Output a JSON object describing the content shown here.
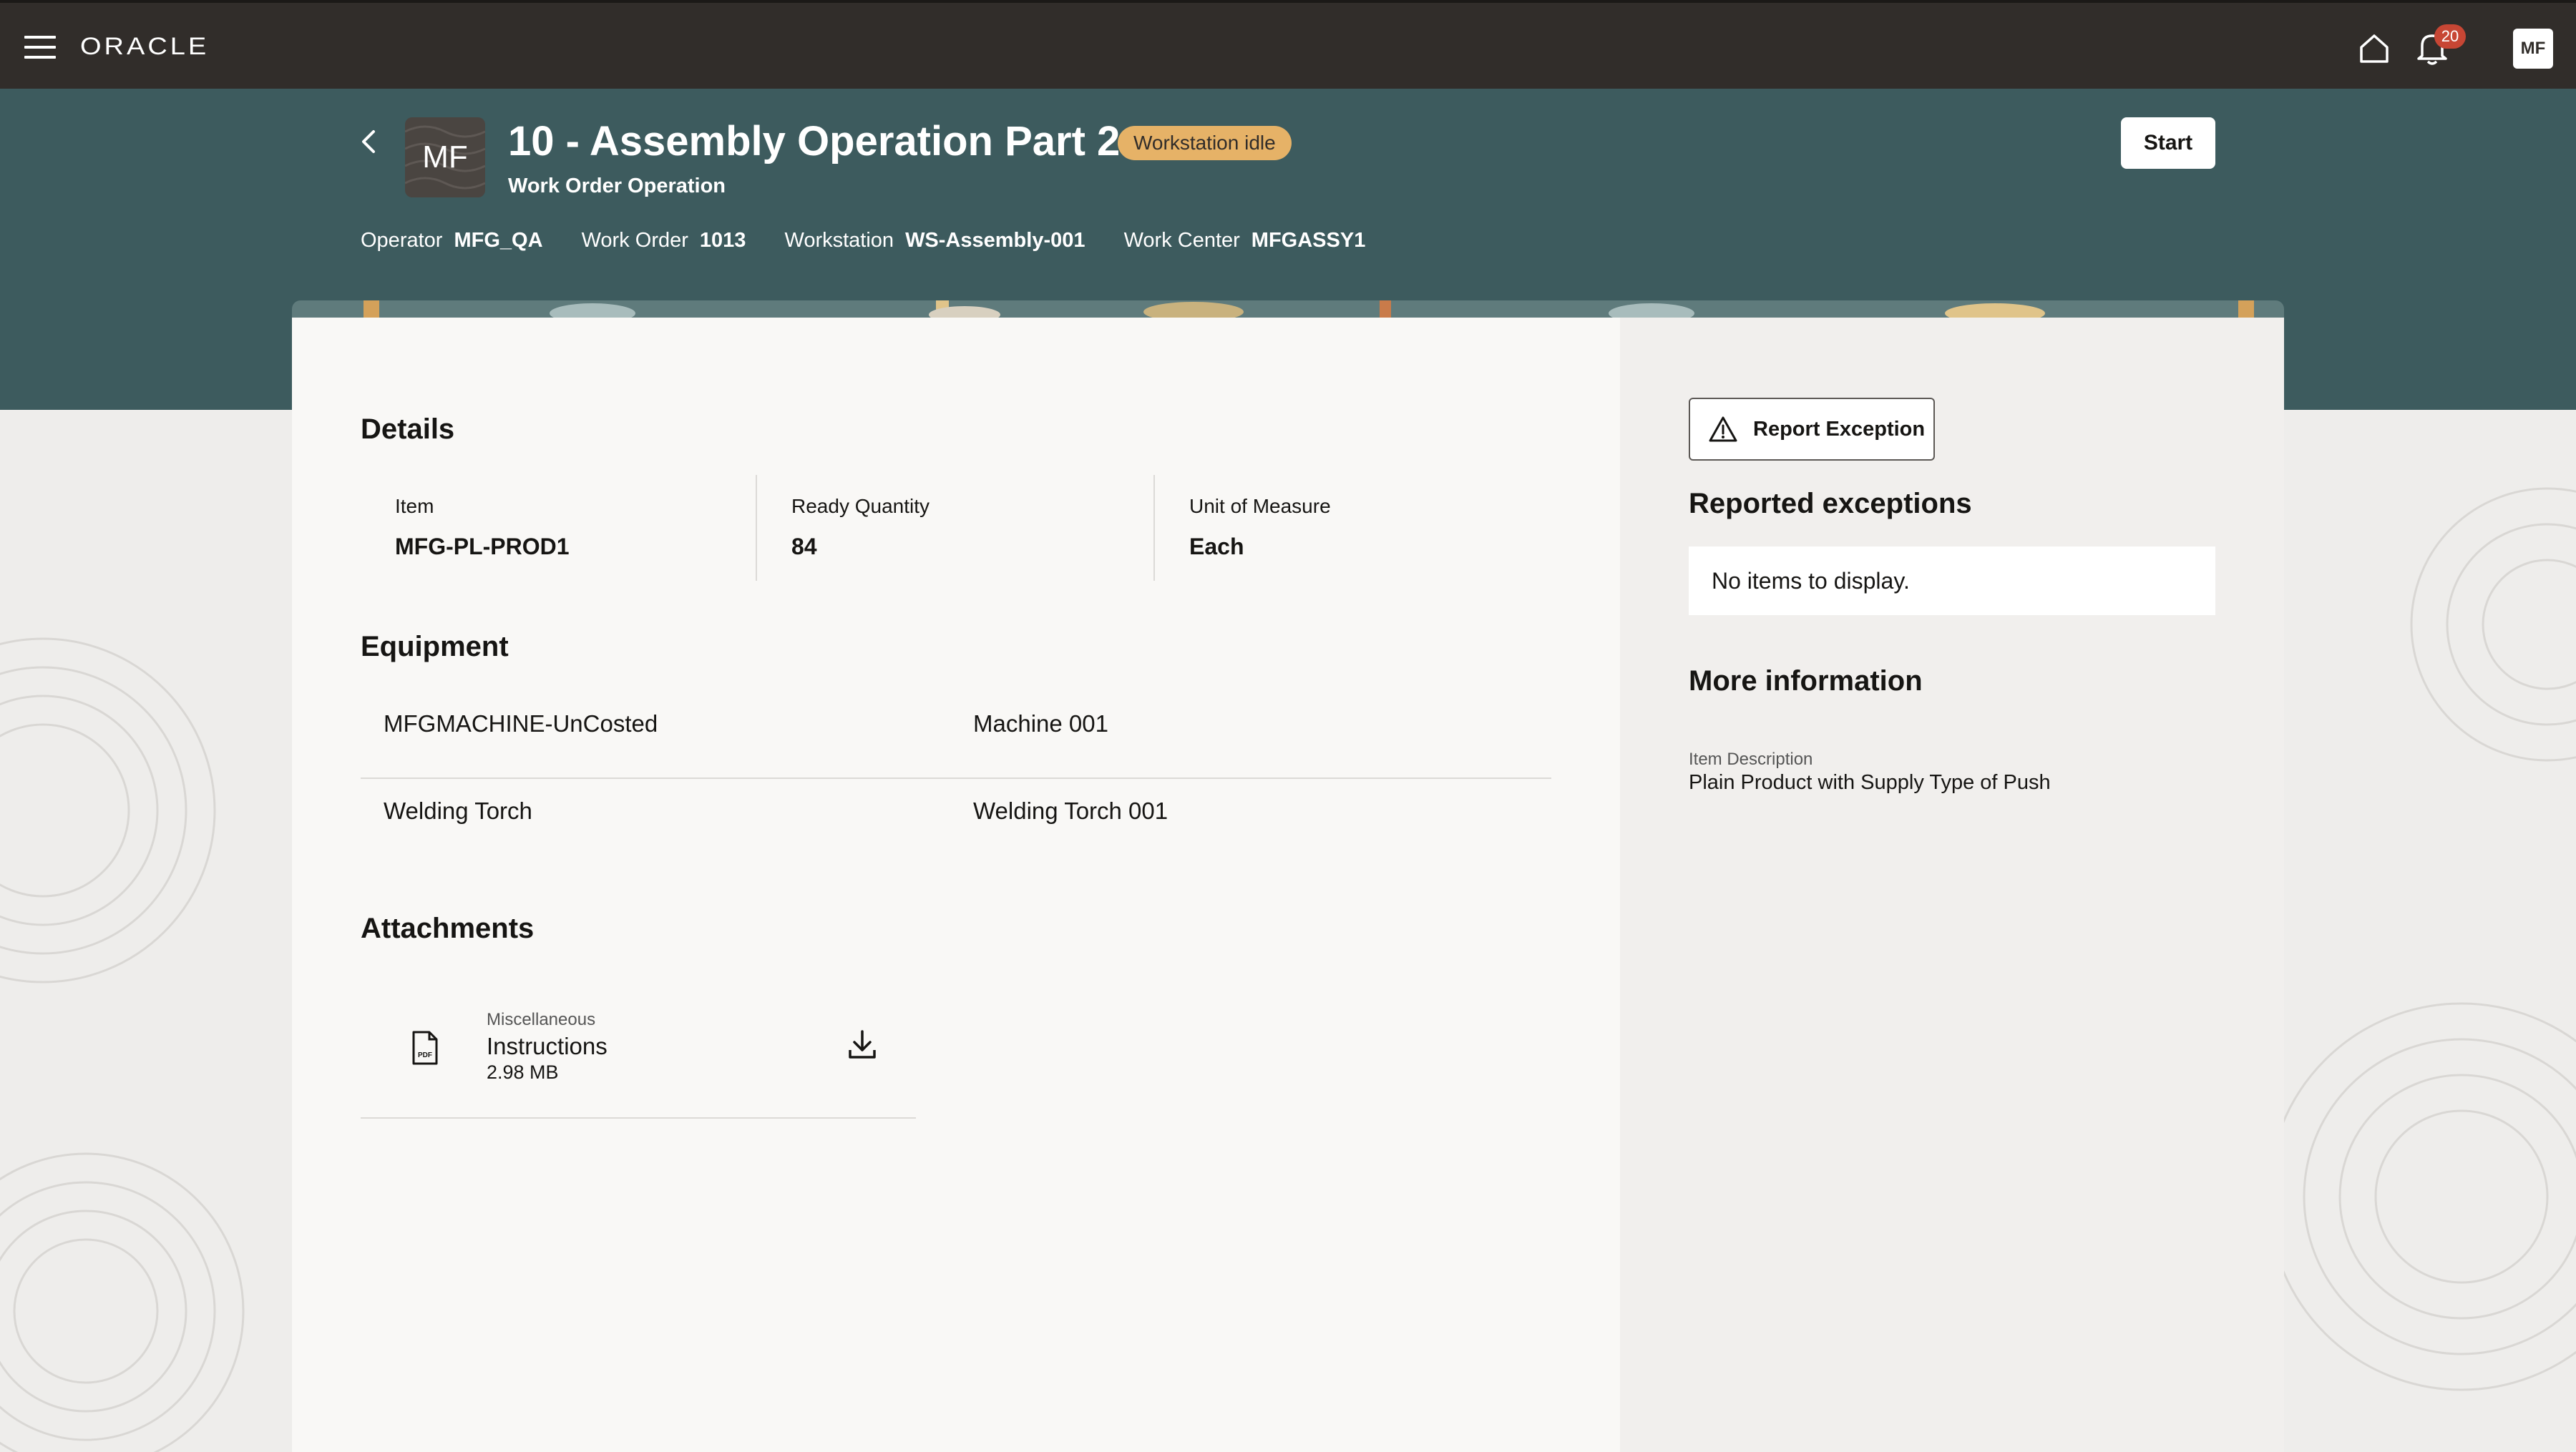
{
  "topbar": {
    "brand": "ORACLE",
    "notification_count": "20",
    "user_initials": "MF"
  },
  "header": {
    "avatar_initials": "MF",
    "title": "10 - Assembly Operation Part 2",
    "status": "Workstation idle",
    "subtitle": "Work Order Operation",
    "start_label": "Start",
    "meta": [
      {
        "label": "Operator",
        "value": "MFG_QA"
      },
      {
        "label": "Work Order",
        "value": "1013"
      },
      {
        "label": "Workstation",
        "value": "WS-Assembly-001"
      },
      {
        "label": "Work Center",
        "value": "MFGASSY1"
      }
    ]
  },
  "details": {
    "heading": "Details",
    "fields": [
      {
        "label": "Item",
        "value": "MFG-PL-PROD1"
      },
      {
        "label": "Ready Quantity",
        "value": "84"
      },
      {
        "label": "Unit of Measure",
        "value": "Each"
      }
    ]
  },
  "equipment": {
    "heading": "Equipment",
    "rows": [
      {
        "type": "MFGMACHINE-UnCosted",
        "name": "Machine 001"
      },
      {
        "type": "Welding Torch",
        "name": "Welding Torch 001"
      }
    ]
  },
  "attachments": {
    "heading": "Attachments",
    "items": [
      {
        "category": "Miscellaneous",
        "name": "Instructions",
        "size": "2.98 MB"
      }
    ]
  },
  "side": {
    "report_exception_label": "Report Exception",
    "reported_heading": "Reported exceptions",
    "empty_text": "No items to display.",
    "more_heading": "More information",
    "more_label": "Item Description",
    "more_value": "Plain Product with Supply Type of Push"
  },
  "colors": {
    "topbar": "#312d2a",
    "header_band": "#3d5b5e",
    "status_badge": "#e6b267",
    "notification_badge": "#c74634"
  }
}
